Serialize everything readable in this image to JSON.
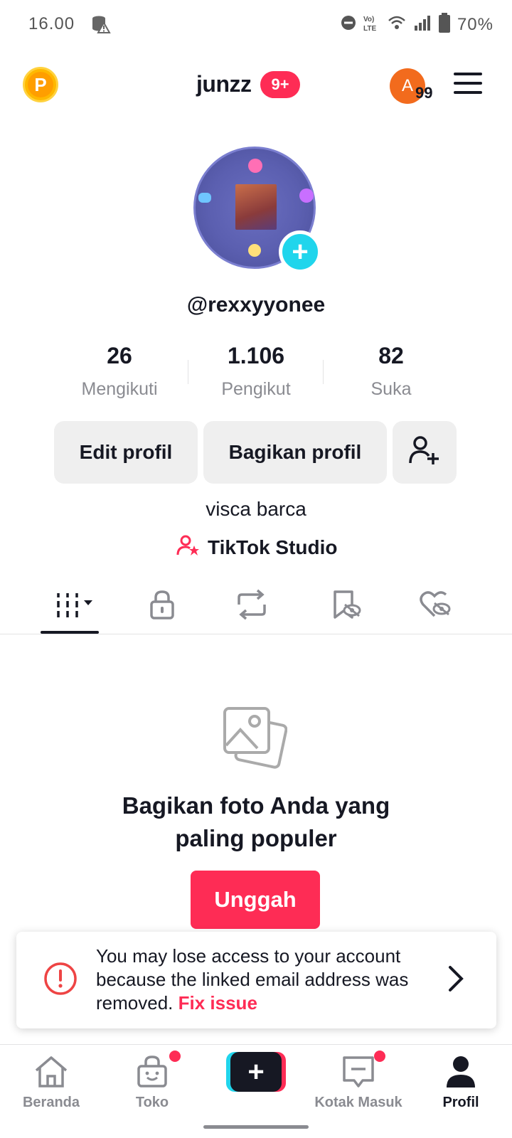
{
  "status_bar": {
    "time": "16.00",
    "battery": "70%",
    "icons": [
      "database-warning-icon",
      "dnd-icon",
      "volte-icon",
      "wifi-icon",
      "signal-icon",
      "battery-icon"
    ]
  },
  "header": {
    "username": "junzz",
    "notification_badge": "9+",
    "story_avatar_letter": "A",
    "story_count": "99"
  },
  "profile": {
    "handle": "@rexxyyonee",
    "bio": "visca barca"
  },
  "stats": [
    {
      "value": "26",
      "label": "Mengikuti"
    },
    {
      "value": "1.106",
      "label": "Pengikut"
    },
    {
      "value": "82",
      "label": "Suka"
    }
  ],
  "actions": {
    "edit_label": "Edit profil",
    "share_label": "Bagikan profil"
  },
  "studio": {
    "label": "TikTok Studio"
  },
  "empty_state": {
    "title_line1": "Bagikan foto Anda yang",
    "title_line2": "paling populer",
    "upload_label": "Unggah"
  },
  "warning": {
    "text": "You may lose access to your account because the linked email address was removed.",
    "link": "Fix issue"
  },
  "nav": {
    "home": "Beranda",
    "shop": "Toko",
    "inbox": "Kotak Masuk",
    "profile": "Profil"
  },
  "colors": {
    "accent": "#fe2c55",
    "cyan": "#20d5ec",
    "text": "#161823",
    "muted": "#8a8b91"
  }
}
